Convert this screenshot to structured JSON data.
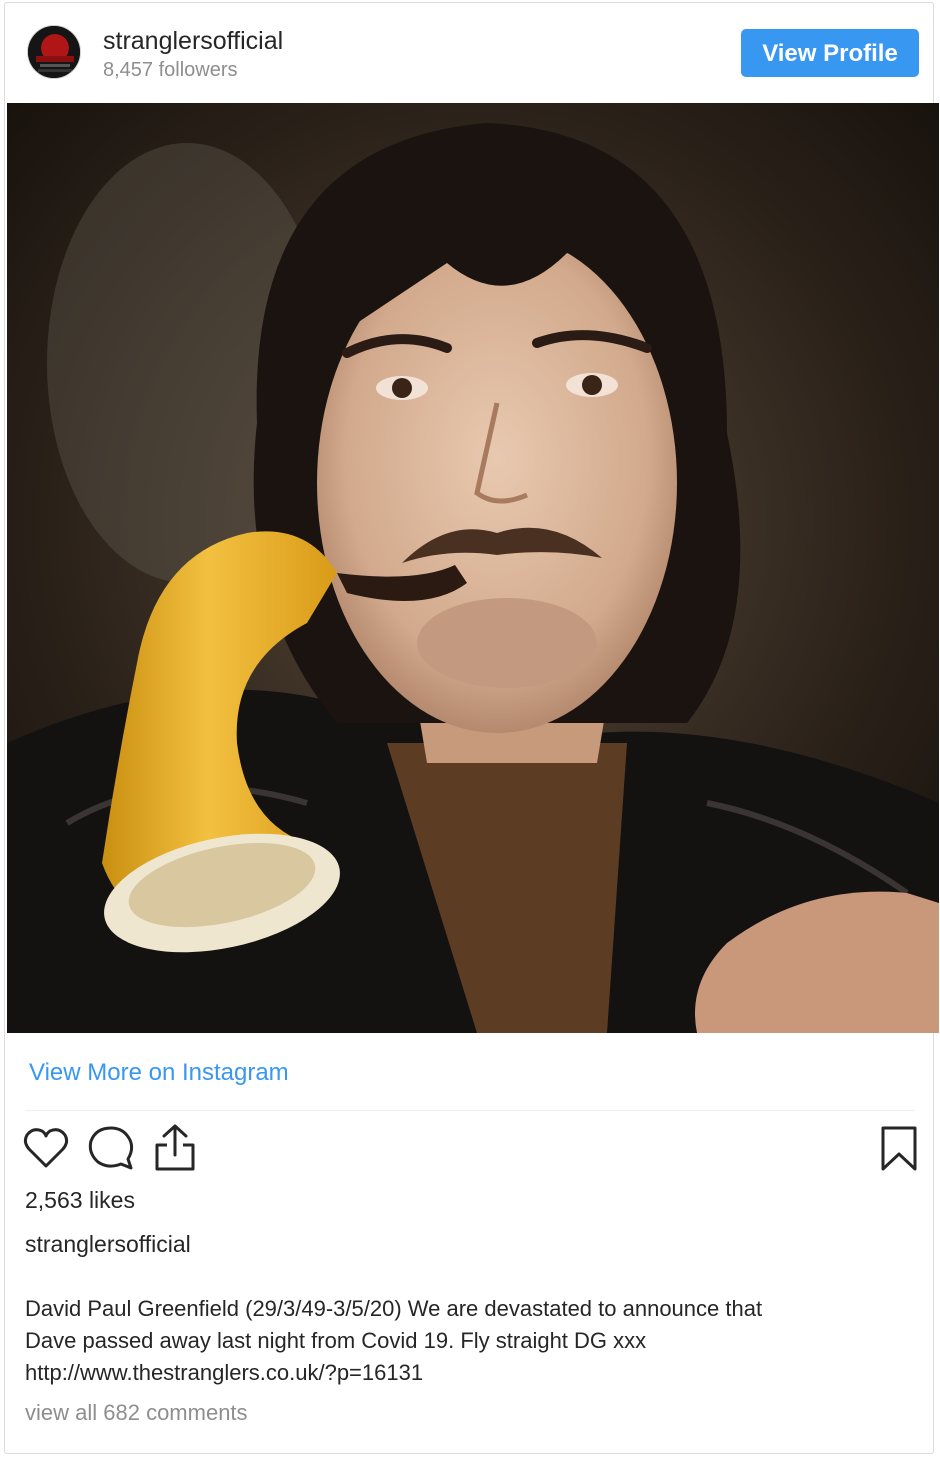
{
  "header": {
    "username": "stranglersofficial",
    "followers": "8,457 followers",
    "view_profile_label": "View Profile"
  },
  "photo": {
    "description_icon": "post-photo"
  },
  "links": {
    "view_more": "View More on Instagram"
  },
  "actions": {
    "icons": [
      "heart-icon",
      "comment-icon",
      "share-icon",
      "bookmark-icon"
    ]
  },
  "post": {
    "likes": "2,563 likes",
    "caption_user": "stranglersofficial",
    "caption_lines": [
      "David Paul Greenfield (29/3/49-3/5/20) We are devastated to announce that",
      "Dave passed away last night from Covid 19. Fly straight DG xxx",
      "http://www.thestranglers.co.uk/?p=16131"
    ],
    "view_comments": "view all 682 comments"
  },
  "colors": {
    "accent": "#3897f0",
    "text": "#262626",
    "muted": "#8e8e8e"
  }
}
